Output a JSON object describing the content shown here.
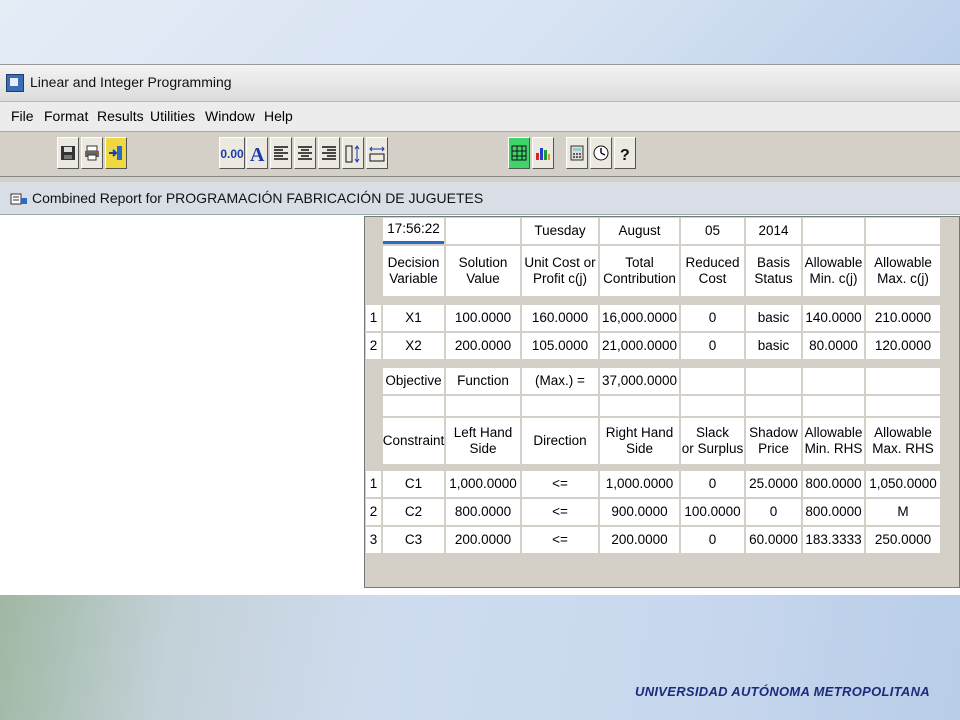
{
  "window": {
    "title": "Linear and Integer Programming"
  },
  "menu": [
    "File",
    "Format",
    "Results",
    "Utilities",
    "Window",
    "Help"
  ],
  "toolbar": {
    "decimal_label": "0.00",
    "icons": [
      "save-icon",
      "print-icon",
      "exit-icon",
      "decimal-icon",
      "font-icon",
      "align-left-icon",
      "align-center-icon",
      "align-right-icon",
      "row-height-icon",
      "column-width-icon",
      "grid-icon",
      "chart-icon",
      "calculator-icon",
      "clock-icon",
      "help-icon"
    ]
  },
  "report": {
    "title": "Combined Report for PROGRAMACIÓN FABRICACIÓN DE JUGUETES",
    "datetime": {
      "time": "17:56:22",
      "day": "Tuesday",
      "month": "August",
      "date": "05",
      "year": "2014"
    },
    "var_headers": [
      "Decision\nVariable",
      "Solution\nValue",
      "Unit Cost or\nProfit c(j)",
      "Total\nContribution",
      "Reduced\nCost",
      "Basis\nStatus",
      "Allowable\nMin. c(j)",
      "Allowable\nMax. c(j)"
    ],
    "variables": [
      {
        "num": "1",
        "name": "X1",
        "solution": "100.0000",
        "unit": "160.0000",
        "total": "16,000.0000",
        "reduced": "0",
        "basis": "basic",
        "min": "140.0000",
        "max": "210.0000"
      },
      {
        "num": "2",
        "name": "X2",
        "solution": "200.0000",
        "unit": "105.0000",
        "total": "21,000.0000",
        "reduced": "0",
        "basis": "basic",
        "min": "80.0000",
        "max": "120.0000"
      }
    ],
    "objective": {
      "c1": "Objective",
      "c2": "Function",
      "c3": "(Max.) =",
      "c4": "37,000.0000"
    },
    "con_headers": [
      "Constraint",
      "Left Hand\nSide",
      "Direction",
      "Right Hand\nSide",
      "Slack\nor Surplus",
      "Shadow\nPrice",
      "Allowable\nMin. RHS",
      "Allowable\nMax. RHS"
    ],
    "constraints": [
      {
        "num": "1",
        "name": "C1",
        "lhs": "1,000.0000",
        "dir": "<=",
        "rhs": "1,000.0000",
        "slack": "0",
        "shadow": "25.0000",
        "min": "800.0000",
        "max": "1,050.0000"
      },
      {
        "num": "2",
        "name": "C2",
        "lhs": "800.0000",
        "dir": "<=",
        "rhs": "900.0000",
        "slack": "100.0000",
        "shadow": "0",
        "min": "800.0000",
        "max": "M"
      },
      {
        "num": "3",
        "name": "C3",
        "lhs": "200.0000",
        "dir": "<=",
        "rhs": "200.0000",
        "slack": "0",
        "shadow": "60.0000",
        "min": "183.3333",
        "max": "250.0000"
      }
    ]
  },
  "footer": "UNIVERSIDAD AUTÓNOMA METROPOLITANA",
  "colors": {
    "toolbar_selected": "#3fd46a",
    "footer_text": "#1b2a7a",
    "window_gray": "#d4d0c8"
  }
}
